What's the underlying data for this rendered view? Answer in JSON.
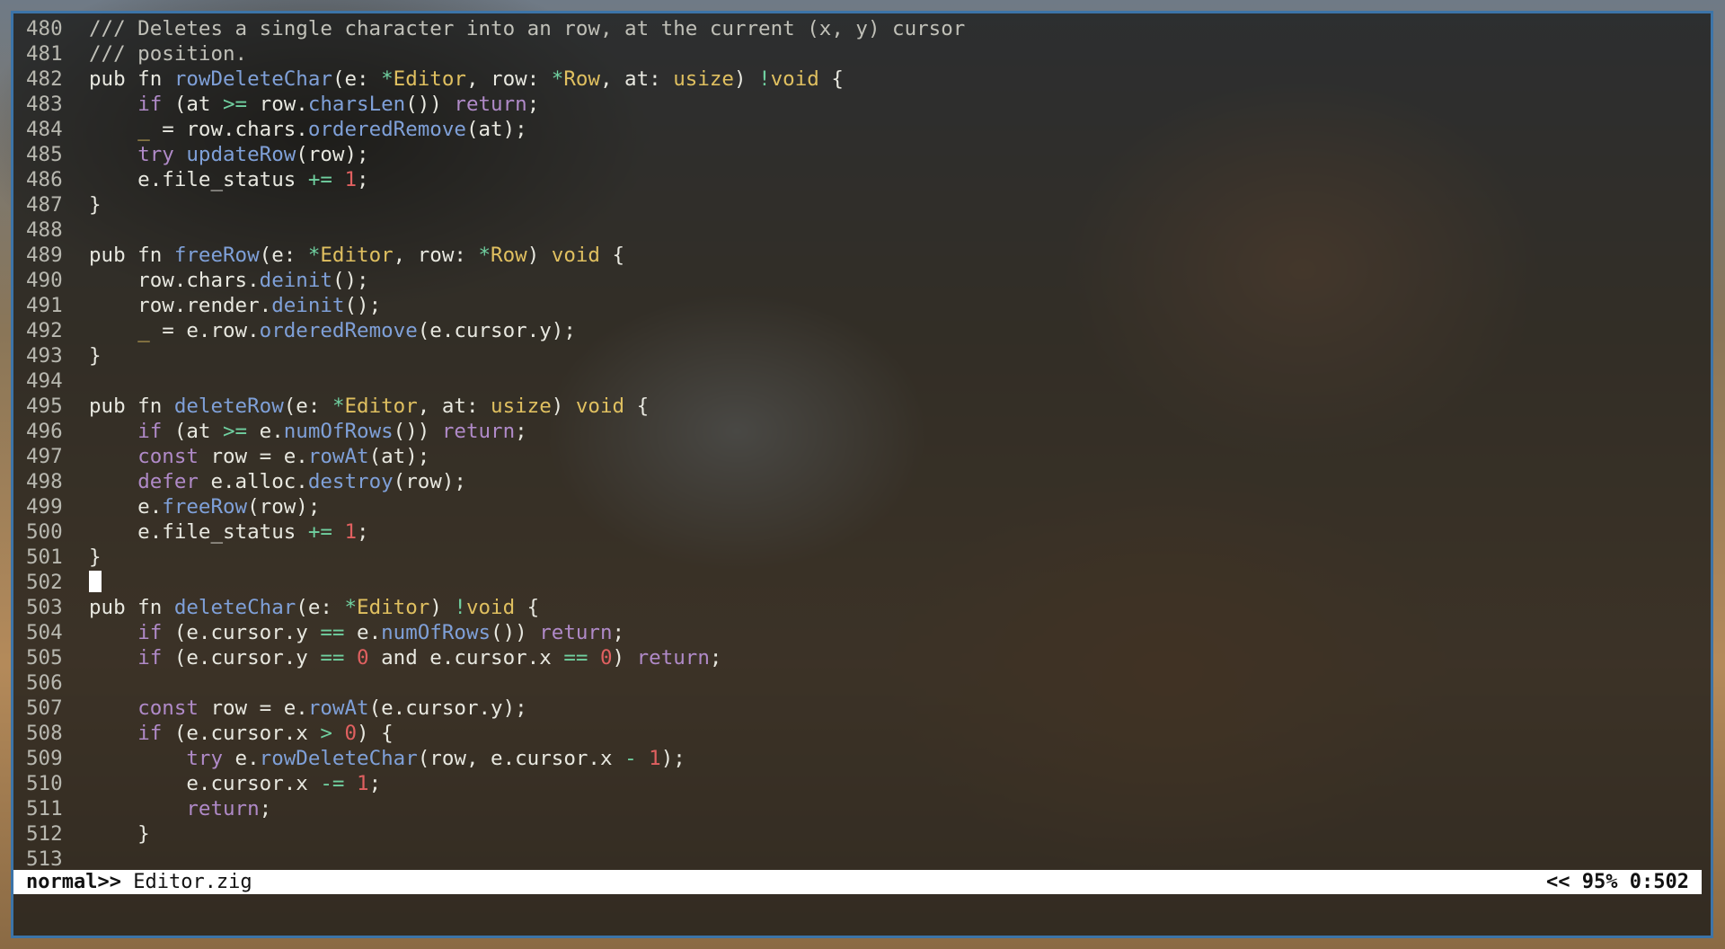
{
  "colors": {
    "default": "#e8e8e0",
    "keyword": "#b08ac8",
    "function": "#7fa0d8",
    "type": "#e0c060",
    "number": "#e06060",
    "operator": "#70d0a0",
    "comment": "#c0c0b8",
    "linenumber": "#b8b8b0",
    "border": "#3c74a8"
  },
  "editor": {
    "lines": [
      {
        "n": "480",
        "t": [
          [
            "c",
            "/// Deletes a single character into an row, at the current (x, y) cursor"
          ]
        ]
      },
      {
        "n": "481",
        "t": [
          [
            "c",
            "/// position."
          ]
        ]
      },
      {
        "n": "482",
        "t": [
          [
            "d",
            "pub fn "
          ],
          [
            "f",
            "rowDeleteChar"
          ],
          [
            "d",
            "(e: "
          ],
          [
            "o",
            "*"
          ],
          [
            "y",
            "Editor"
          ],
          [
            "d",
            ", row: "
          ],
          [
            "o",
            "*"
          ],
          [
            "y",
            "Row"
          ],
          [
            "d",
            ", at: "
          ],
          [
            "y",
            "usize"
          ],
          [
            "d",
            ") "
          ],
          [
            "o",
            "!"
          ],
          [
            "y",
            "void"
          ],
          [
            "d",
            " {"
          ]
        ]
      },
      {
        "n": "483",
        "t": [
          [
            "d",
            "    "
          ],
          [
            "k",
            "if"
          ],
          [
            "d",
            " (at "
          ],
          [
            "o",
            ">="
          ],
          [
            "d",
            " row."
          ],
          [
            "f",
            "charsLen"
          ],
          [
            "d",
            "()) "
          ],
          [
            "k",
            "return"
          ],
          [
            "d",
            ";"
          ]
        ]
      },
      {
        "n": "484",
        "t": [
          [
            "d",
            "    "
          ],
          [
            "y",
            "_"
          ],
          [
            "d",
            " = row.chars."
          ],
          [
            "f",
            "orderedRemove"
          ],
          [
            "d",
            "(at);"
          ]
        ]
      },
      {
        "n": "485",
        "t": [
          [
            "d",
            "    "
          ],
          [
            "k",
            "try"
          ],
          [
            "d",
            " "
          ],
          [
            "f",
            "updateRow"
          ],
          [
            "d",
            "(row);"
          ]
        ]
      },
      {
        "n": "486",
        "t": [
          [
            "d",
            "    e.file_status "
          ],
          [
            "o",
            "+="
          ],
          [
            "d",
            " "
          ],
          [
            "r",
            "1"
          ],
          [
            "d",
            ";"
          ]
        ]
      },
      {
        "n": "487",
        "t": [
          [
            "d",
            "}"
          ]
        ]
      },
      {
        "n": "488",
        "t": []
      },
      {
        "n": "489",
        "t": [
          [
            "d",
            "pub fn "
          ],
          [
            "f",
            "freeRow"
          ],
          [
            "d",
            "(e: "
          ],
          [
            "o",
            "*"
          ],
          [
            "y",
            "Editor"
          ],
          [
            "d",
            ", row: "
          ],
          [
            "o",
            "*"
          ],
          [
            "y",
            "Row"
          ],
          [
            "d",
            ") "
          ],
          [
            "y",
            "void"
          ],
          [
            "d",
            " {"
          ]
        ]
      },
      {
        "n": "490",
        "t": [
          [
            "d",
            "    row.chars."
          ],
          [
            "f",
            "deinit"
          ],
          [
            "d",
            "();"
          ]
        ]
      },
      {
        "n": "491",
        "t": [
          [
            "d",
            "    row.render."
          ],
          [
            "f",
            "deinit"
          ],
          [
            "d",
            "();"
          ]
        ]
      },
      {
        "n": "492",
        "t": [
          [
            "d",
            "    "
          ],
          [
            "y",
            "_"
          ],
          [
            "d",
            " = e.row."
          ],
          [
            "f",
            "orderedRemove"
          ],
          [
            "d",
            "(e.cursor.y);"
          ]
        ]
      },
      {
        "n": "493",
        "t": [
          [
            "d",
            "}"
          ]
        ]
      },
      {
        "n": "494",
        "t": []
      },
      {
        "n": "495",
        "t": [
          [
            "d",
            "pub fn "
          ],
          [
            "f",
            "deleteRow"
          ],
          [
            "d",
            "(e: "
          ],
          [
            "o",
            "*"
          ],
          [
            "y",
            "Editor"
          ],
          [
            "d",
            ", at: "
          ],
          [
            "y",
            "usize"
          ],
          [
            "d",
            ") "
          ],
          [
            "y",
            "void"
          ],
          [
            "d",
            " {"
          ]
        ]
      },
      {
        "n": "496",
        "t": [
          [
            "d",
            "    "
          ],
          [
            "k",
            "if"
          ],
          [
            "d",
            " (at "
          ],
          [
            "o",
            ">="
          ],
          [
            "d",
            " e."
          ],
          [
            "f",
            "numOfRows"
          ],
          [
            "d",
            "()) "
          ],
          [
            "k",
            "return"
          ],
          [
            "d",
            ";"
          ]
        ]
      },
      {
        "n": "497",
        "t": [
          [
            "d",
            "    "
          ],
          [
            "k",
            "const"
          ],
          [
            "d",
            " row = e."
          ],
          [
            "f",
            "rowAt"
          ],
          [
            "d",
            "(at);"
          ]
        ]
      },
      {
        "n": "498",
        "t": [
          [
            "d",
            "    "
          ],
          [
            "k",
            "defer"
          ],
          [
            "d",
            " e.alloc."
          ],
          [
            "f",
            "destroy"
          ],
          [
            "d",
            "(row);"
          ]
        ]
      },
      {
        "n": "499",
        "t": [
          [
            "d",
            "    e."
          ],
          [
            "f",
            "freeRow"
          ],
          [
            "d",
            "(row);"
          ]
        ]
      },
      {
        "n": "500",
        "t": [
          [
            "d",
            "    e.file_status "
          ],
          [
            "o",
            "+="
          ],
          [
            "d",
            " "
          ],
          [
            "r",
            "1"
          ],
          [
            "d",
            ";"
          ]
        ]
      },
      {
        "n": "501",
        "t": [
          [
            "d",
            "}"
          ]
        ]
      },
      {
        "n": "502",
        "t": [],
        "cursor": true
      },
      {
        "n": "503",
        "t": [
          [
            "d",
            "pub fn "
          ],
          [
            "f",
            "deleteChar"
          ],
          [
            "d",
            "(e: "
          ],
          [
            "o",
            "*"
          ],
          [
            "y",
            "Editor"
          ],
          [
            "d",
            ") "
          ],
          [
            "o",
            "!"
          ],
          [
            "y",
            "void"
          ],
          [
            "d",
            " {"
          ]
        ]
      },
      {
        "n": "504",
        "t": [
          [
            "d",
            "    "
          ],
          [
            "k",
            "if"
          ],
          [
            "d",
            " (e.cursor.y "
          ],
          [
            "o",
            "=="
          ],
          [
            "d",
            " e."
          ],
          [
            "f",
            "numOfRows"
          ],
          [
            "d",
            "()) "
          ],
          [
            "k",
            "return"
          ],
          [
            "d",
            ";"
          ]
        ]
      },
      {
        "n": "505",
        "t": [
          [
            "d",
            "    "
          ],
          [
            "k",
            "if"
          ],
          [
            "d",
            " (e.cursor.y "
          ],
          [
            "o",
            "=="
          ],
          [
            "d",
            " "
          ],
          [
            "r",
            "0"
          ],
          [
            "d",
            " and e.cursor.x "
          ],
          [
            "o",
            "=="
          ],
          [
            "d",
            " "
          ],
          [
            "r",
            "0"
          ],
          [
            "d",
            ") "
          ],
          [
            "k",
            "return"
          ],
          [
            "d",
            ";"
          ]
        ]
      },
      {
        "n": "506",
        "t": []
      },
      {
        "n": "507",
        "t": [
          [
            "d",
            "    "
          ],
          [
            "k",
            "const"
          ],
          [
            "d",
            " row = e."
          ],
          [
            "f",
            "rowAt"
          ],
          [
            "d",
            "(e.cursor.y);"
          ]
        ]
      },
      {
        "n": "508",
        "t": [
          [
            "d",
            "    "
          ],
          [
            "k",
            "if"
          ],
          [
            "d",
            " (e.cursor.x "
          ],
          [
            "o",
            ">"
          ],
          [
            "d",
            " "
          ],
          [
            "r",
            "0"
          ],
          [
            "d",
            ") {"
          ]
        ]
      },
      {
        "n": "509",
        "t": [
          [
            "d",
            "        "
          ],
          [
            "k",
            "try"
          ],
          [
            "d",
            " e."
          ],
          [
            "f",
            "rowDeleteChar"
          ],
          [
            "d",
            "(row, e.cursor.x "
          ],
          [
            "o",
            "-"
          ],
          [
            "d",
            " "
          ],
          [
            "r",
            "1"
          ],
          [
            "d",
            ");"
          ]
        ]
      },
      {
        "n": "510",
        "t": [
          [
            "d",
            "        e.cursor.x "
          ],
          [
            "o",
            "-="
          ],
          [
            "d",
            " "
          ],
          [
            "r",
            "1"
          ],
          [
            "d",
            ";"
          ]
        ]
      },
      {
        "n": "511",
        "t": [
          [
            "d",
            "        "
          ],
          [
            "k",
            "return"
          ],
          [
            "d",
            ";"
          ]
        ]
      },
      {
        "n": "512",
        "t": [
          [
            "d",
            "    }"
          ]
        ]
      },
      {
        "n": "513",
        "t": []
      }
    ]
  },
  "statusbar": {
    "mode": "normal>>",
    "filename": " Editor.zig",
    "position": "<< 95% 0:502"
  }
}
